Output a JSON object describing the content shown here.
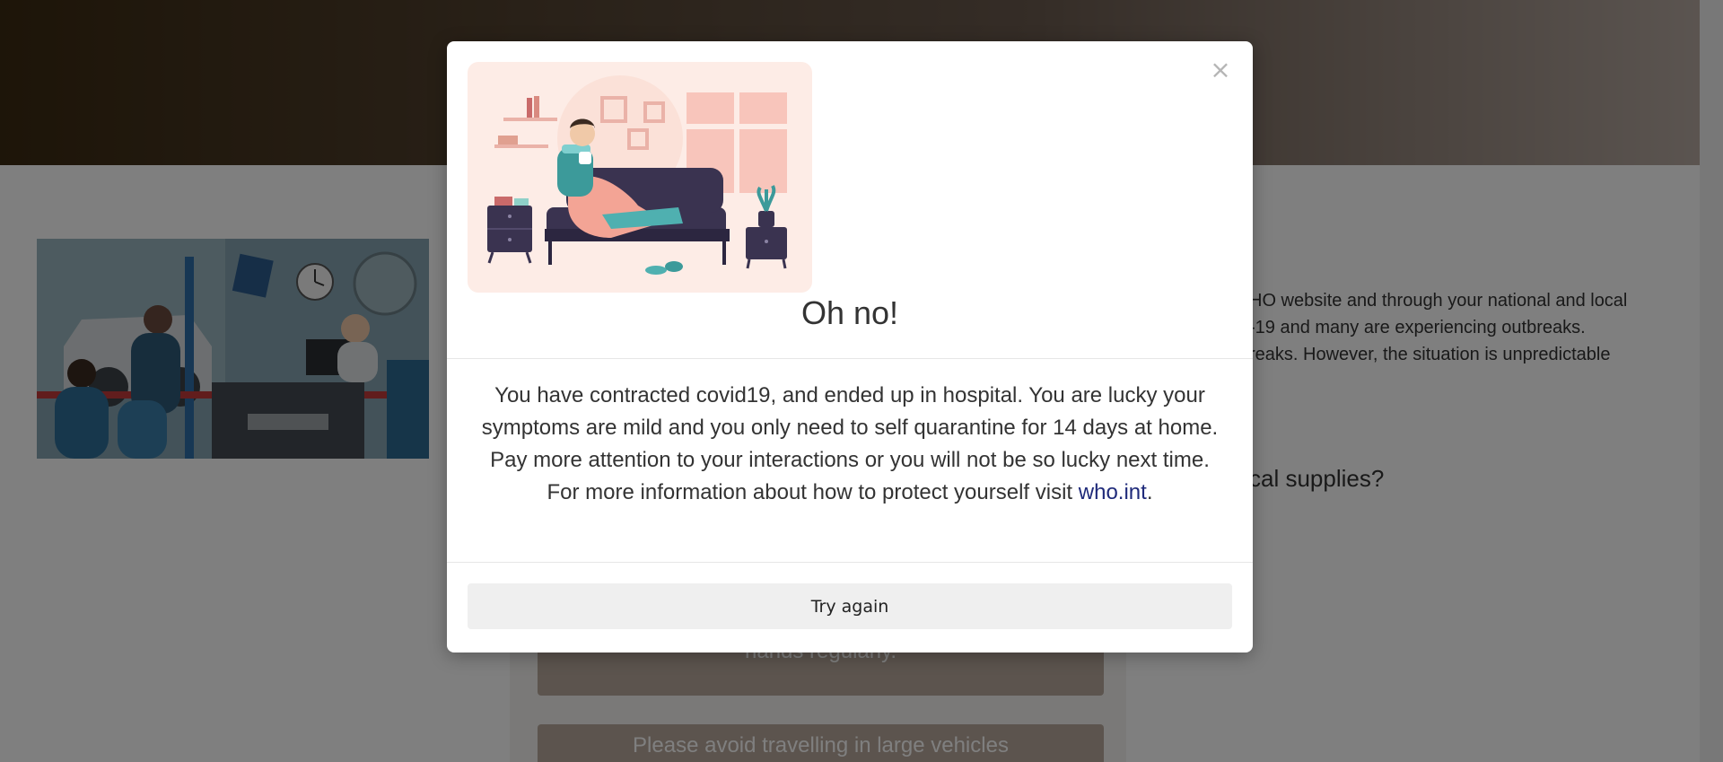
{
  "background": {
    "right_text_lines": [
      "HO website and through your national and local",
      "-19 and many are experiencing outbreaks.",
      "reaks. However, the situation is unpredictable"
    ],
    "right_question": "cal supplies?",
    "card_one_text": "hands regularly.",
    "card_two_text": "Please avoid travelling in large vehicles"
  },
  "modal": {
    "title": "Oh no!",
    "close_label": "×",
    "body_text": "You have contracted covid19, and ended up in hospital. You are lucky your symptoms are mild and you only need to self quarantine for 14 days at home. Pay more attention to your interactions or you will not be so lucky next time.",
    "info_prefix": "For more information about how to protect yourself visit ",
    "info_link": "who.int",
    "info_suffix": ".",
    "button_label": "Try again"
  },
  "colors": {
    "link": "#1f2a7a",
    "button_bg": "#efefef",
    "card_bg": "#b9a99d",
    "illustration_bg": "#fdece6"
  }
}
